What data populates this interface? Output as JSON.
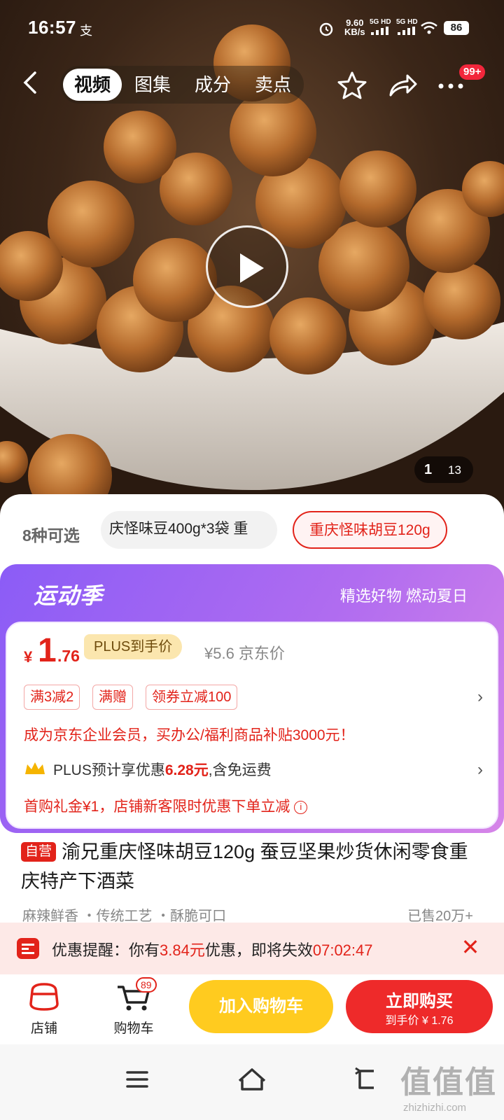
{
  "status_bar": {
    "time": "16:57",
    "extra_icon": "支",
    "network_speed": "9.60",
    "network_unit": "KB/s",
    "signal_1": "5G HD",
    "signal_2": "5G HD",
    "battery": "86"
  },
  "header": {
    "tabs": [
      {
        "label": "视频",
        "active": true
      },
      {
        "label": "图集",
        "active": false
      },
      {
        "label": "成分",
        "active": false
      },
      {
        "label": "卖点",
        "active": false
      }
    ],
    "more_badge": "99+"
  },
  "gallery": {
    "current": "1",
    "total": "13"
  },
  "variants": {
    "count_label": "8种可选",
    "chip_1": "庆怪味豆400g*3袋 重",
    "chip_selected": "重庆怪味胡豆120g"
  },
  "promo": {
    "event_title": "运动季",
    "slogan": "精选好物 燃动夏日",
    "price_symbol": "¥",
    "price_int": "1",
    "price_dec": ".76",
    "price_badge": "PLUS到手价",
    "original_price": "¥5.6 京东价",
    "tags": [
      "满3减2",
      "满赠",
      "领券立减100"
    ],
    "business_text": "成为京东企业会员，买办公/福利商品补贴3000元！",
    "plus_prefix": "PLUS预计享优惠",
    "plus_amount": "6.28元",
    "plus_suffix": ",含免运费",
    "gift_text": "首购礼金¥1，店铺新客限时优惠下单立减",
    "accent_color": "#e2231a",
    "gradient_color": "#8b5cf6"
  },
  "product": {
    "self_tag": "自营",
    "title": "渝兄重庆怪味胡豆120g 蚕豆坚果炒货休闲零食重庆特产下酒菜",
    "features": "麻辣鲜香 ・传统工艺 ・酥脆可口",
    "sold": "已售20万+"
  },
  "reminder": {
    "prefix": "优惠提醒：你有",
    "amount": "3.84元",
    "middle": "优惠，即将失效",
    "countdown": "07:02:47"
  },
  "bottom_bar": {
    "shop_label": "店铺",
    "cart_label": "购物车",
    "cart_badge": "89",
    "add_to_cart": "加入购物车",
    "buy_now": "立即购买",
    "buy_price": "到手价 ¥ 1.76"
  },
  "watermark": {
    "big": "值值值",
    "small": "zhizhizhi.com"
  }
}
